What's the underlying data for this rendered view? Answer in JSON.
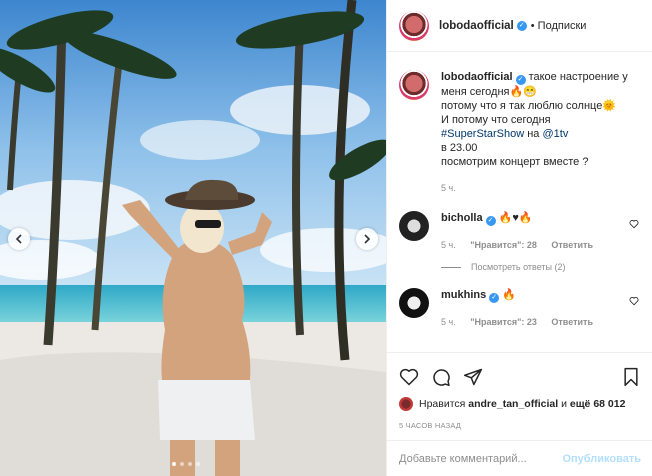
{
  "post": {
    "username": "lobodaofficial",
    "follow_label": "• Подписки",
    "caption_lines": [
      "такое настроение у",
      "меня сегодня",
      "потому что я так люблю солнце",
      "И потому что сегодня",
      "#SuperStarShow на @1tv",
      "в 23.00",
      "посмотрим концерт вместе ?"
    ],
    "caption_hashtag": "#SuperStarShow",
    "caption_on": "на",
    "caption_mention": "@1tv",
    "caption_time": "5 ч."
  },
  "comments": [
    {
      "username": "bicholla",
      "time": "5 ч.",
      "likes": "\"Нравится\": 28",
      "reply": "Ответить",
      "view_replies": "Посмотреть ответы (2)"
    },
    {
      "username": "mukhins",
      "time": "5 ч.",
      "likes": "\"Нравится\": 23",
      "reply": "Ответить"
    }
  ],
  "likes": {
    "prefix": "Нравится",
    "user": "andre_tan_official",
    "mid": "и",
    "count": "ещё 68 012"
  },
  "timestamp": "5 ЧАСОВ НАЗАД",
  "comment_box": {
    "placeholder": "Добавьте комментарий...",
    "publish_label": "Опубликовать"
  },
  "carousel": {
    "slides": 4,
    "active": 1
  },
  "icons": [
    "chevron-left-icon",
    "chevron-right-icon",
    "heart-icon",
    "comment-icon",
    "share-icon",
    "bookmark-icon",
    "verified-icon"
  ],
  "colors": {
    "link": "#00376b",
    "verified": "#3897f0",
    "publish_disabled": "#b2dffc",
    "muted": "#8e8e8e"
  }
}
